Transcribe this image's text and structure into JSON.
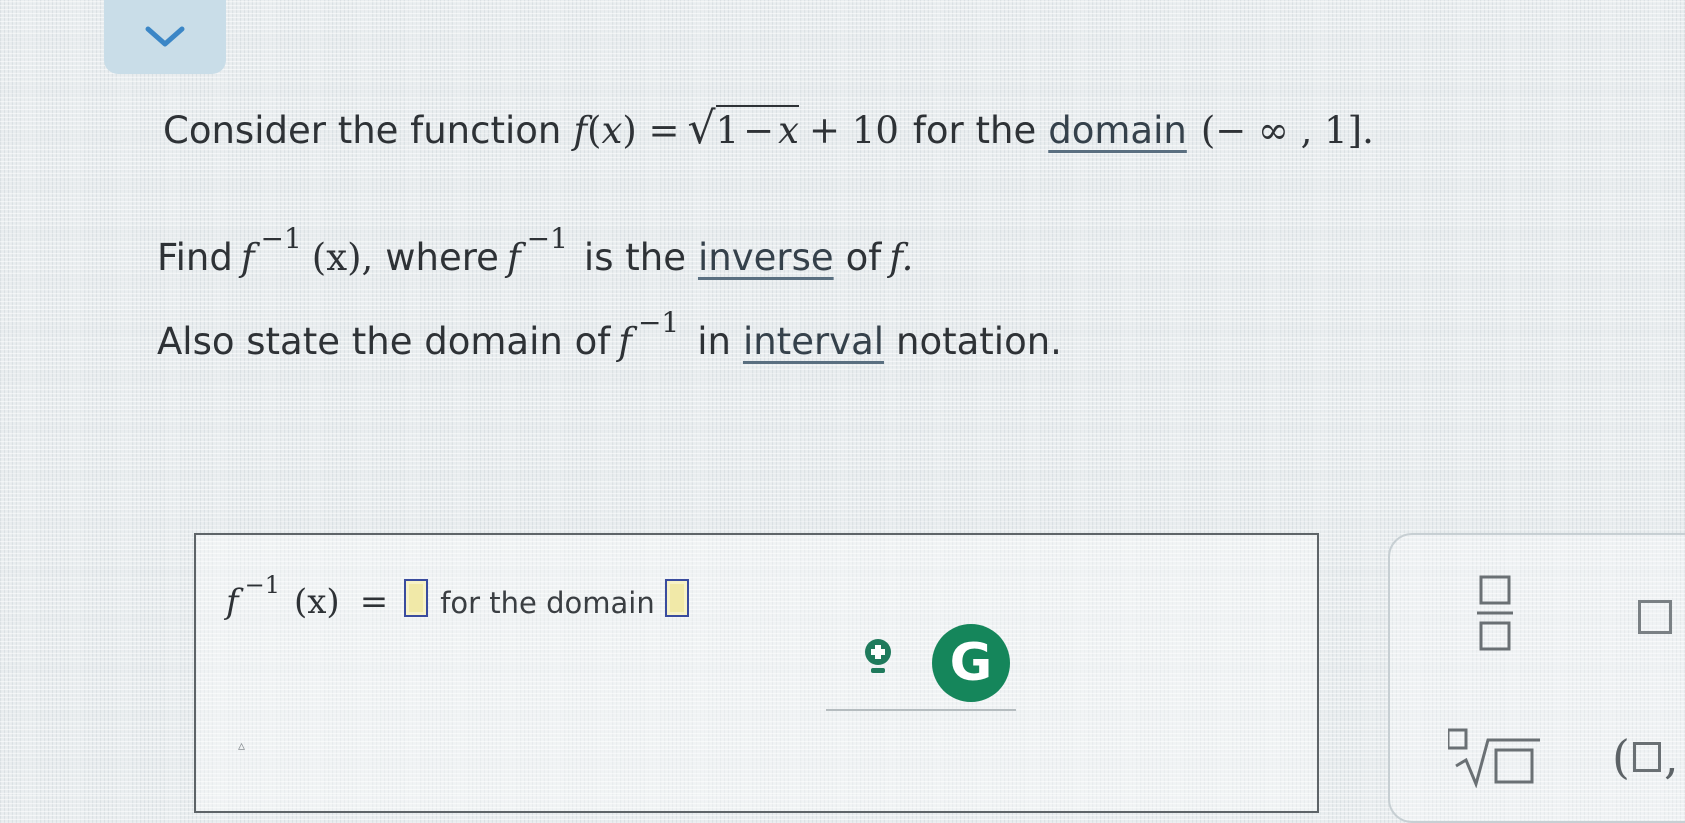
{
  "question": {
    "line1": {
      "lead": "Consider the function",
      "f": "f",
      "open_paren": "(",
      "x": "x",
      "close_paren_eq": ") =",
      "radicand_1": "1",
      "radicand_minus": "−",
      "radicand_x": "x",
      "plus_ten": "+ 10",
      "for_the": "for the",
      "domain_link": "domain",
      "interval": "(− ∞ , 1].",
      "period": ""
    },
    "line2": {
      "find": "Find",
      "f": "f",
      "exponent": "−1",
      "arg": "(x),",
      "where": "where",
      "f2": "f",
      "exponent2": "−1",
      "is_the": "is the",
      "inverse_link": "inverse",
      "of": "of",
      "f3": "f."
    },
    "line3": {
      "also": "Also state the domain of",
      "f": "f",
      "exponent": "−1",
      "in": "in",
      "interval_link": "interval",
      "notation": "notation."
    }
  },
  "answer": {
    "f": "f",
    "exponent": "−1",
    "arg": "(x)",
    "equals": "=",
    "for_the_domain": "for the domain"
  },
  "icons": {
    "collapse": "chevron-down-icon",
    "hint": "lightbulb-icon",
    "grammarly": "grammarly-g-icon",
    "grammarly_letter": "G"
  },
  "palette": {
    "fraction": "fraction-template-icon",
    "superscript": "box-template-icon",
    "nth_root": "nth-root-template-icon",
    "interval_open": "(",
    "interval_comma": ","
  },
  "colors": {
    "collapse_tab": "#c9dde8",
    "chevron": "#3b86c6",
    "blank_fill": "#f1e9a8",
    "blank_border": "#3a4c9e",
    "grammarly": "#15865b",
    "hint_bulb": "#1f7a5c"
  }
}
